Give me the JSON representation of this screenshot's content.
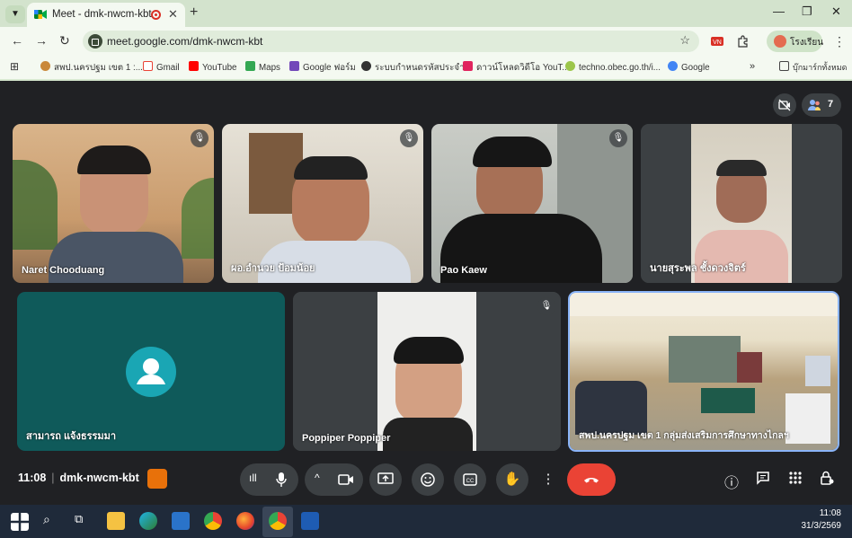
{
  "browser": {
    "tab_title": "Meet - dmk-nwcm-kbt",
    "url": "meet.google.com/dmk-nwcm-kbt",
    "profile_label": "โรงเรียน",
    "bookmarks": [
      "สพป.นครปฐม เขต 1 :...",
      "Gmail",
      "YouTube",
      "Maps",
      "Google ฟอร์ม",
      "ระบบกำหนดรหัสประจำ...",
      "ดาวน์โหลดวิดีโอ YouT...",
      "techno.obec.go.th/i...",
      "Google"
    ],
    "all_bookmarks": "บุ๊กมาร์กทั้งหมด"
  },
  "meet": {
    "participant_count": "7",
    "participants": [
      {
        "name": "Naret Chooduang"
      },
      {
        "name": "ผอ.อำนวย ป้อมน้อย"
      },
      {
        "name": "Pao Kaew"
      },
      {
        "name": "นายสุระพล ชั้งดวงจิตร์"
      },
      {
        "name": "สามารถ แจ้งธรรมมา"
      },
      {
        "name": "Poppiper Poppiper"
      },
      {
        "name": "สพป.นครปฐม เขต 1 กลุ่มส่งเสริมการศึกษาทางไกลฯ"
      }
    ],
    "time": "11:08",
    "meeting_code": "dmk-nwcm-kbt"
  },
  "taskbar": {
    "time": "11:08",
    "date": "31/3/2569"
  },
  "colors": {
    "browser_green": "#d3e3cd",
    "meet_bg": "#202124",
    "end_call": "#ea4335",
    "avatar_tile": "#0f5a5a"
  }
}
